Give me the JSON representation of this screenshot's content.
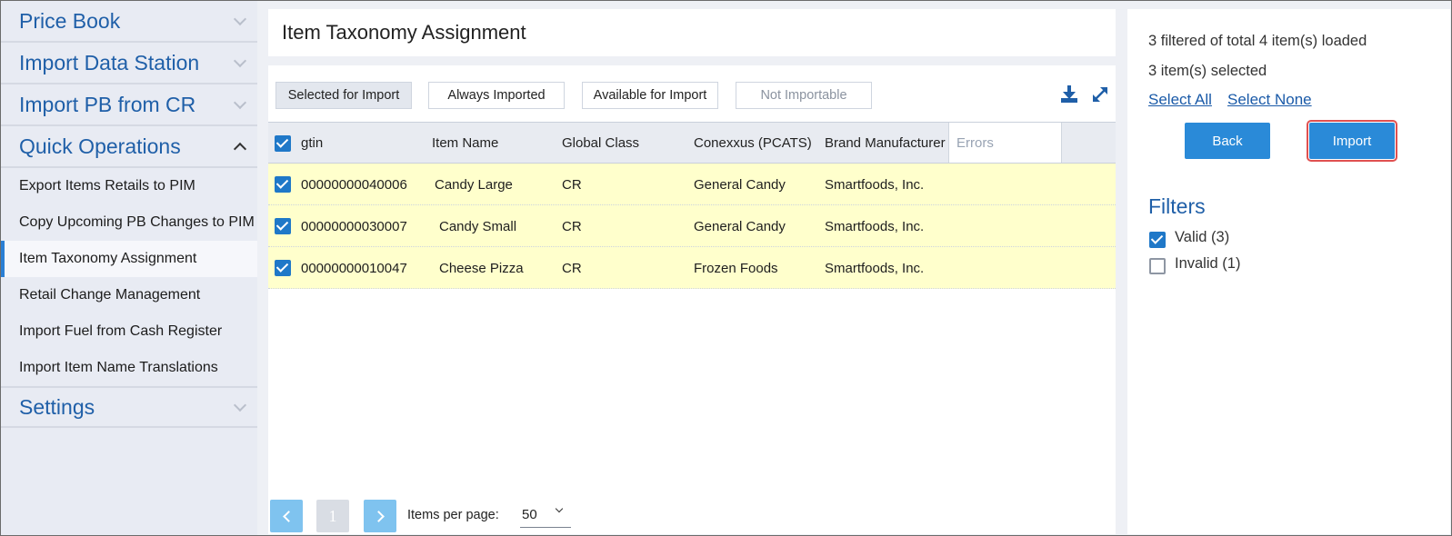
{
  "sidebar": {
    "sections": [
      {
        "label": "Price Book"
      },
      {
        "label": "Import Data Station"
      },
      {
        "label": "Import PB from CR"
      },
      {
        "label": "Quick Operations"
      },
      {
        "label": "Settings"
      }
    ],
    "quick_operations_items": [
      {
        "label": "Export Items Retails to PIM"
      },
      {
        "label": "Copy Upcoming PB Changes to PIM"
      },
      {
        "label": "Item Taxonomy Assignment"
      },
      {
        "label": "Retail Change Management"
      },
      {
        "label": "Import Fuel from Cash Register"
      },
      {
        "label": "Import Item Name Translations"
      }
    ],
    "active_item": "Item Taxonomy Assignment"
  },
  "main": {
    "title": "Item Taxonomy Assignment",
    "tabs": [
      {
        "label": "Selected for Import",
        "state": "active"
      },
      {
        "label": "Always Imported",
        "state": "normal"
      },
      {
        "label": "Available for Import",
        "state": "normal"
      },
      {
        "label": "Not Importable",
        "state": "disabled"
      }
    ],
    "icons": [
      "download-icon",
      "expand-icon"
    ],
    "columns": [
      "gtin",
      "Item Name",
      "Global Class",
      "Conexxus (PCATS)",
      "Brand Manufacturer",
      "Errors"
    ],
    "rows": [
      {
        "checked": true,
        "gtin": "00000000040006",
        "item_name": "Candy Large",
        "global_class": "CR",
        "conexxus": "General Candy",
        "brand": "Smartfoods, Inc.",
        "errors": ""
      },
      {
        "checked": true,
        "gtin": "00000000030007",
        "item_name": "Candy Small",
        "global_class": "CR",
        "conexxus": "General Candy",
        "brand": "Smartfoods, Inc.",
        "errors": ""
      },
      {
        "checked": true,
        "gtin": "00000000010047",
        "item_name": "Cheese Pizza",
        "global_class": "CR",
        "conexxus": "Frozen Foods",
        "brand": "Smartfoods, Inc.",
        "errors": ""
      }
    ],
    "pager": {
      "current_page": "1",
      "items_per_page_label": "Items per page:",
      "items_per_page": "50"
    }
  },
  "right": {
    "summary_loaded": "3 filtered of total 4 item(s) loaded",
    "summary_selected": "3 item(s) selected",
    "select_all": "Select All",
    "select_none": "Select None",
    "back": "Back",
    "import": "Import",
    "filters_title": "Filters",
    "filters": [
      {
        "label": "Valid (3)",
        "checked": true
      },
      {
        "label": "Invalid (1)",
        "checked": false
      }
    ]
  },
  "colors": {
    "accent": "#2a8ad8",
    "link": "#1a5aa8",
    "row_highlight": "#ffffcc",
    "import_outline": "#e05050"
  }
}
